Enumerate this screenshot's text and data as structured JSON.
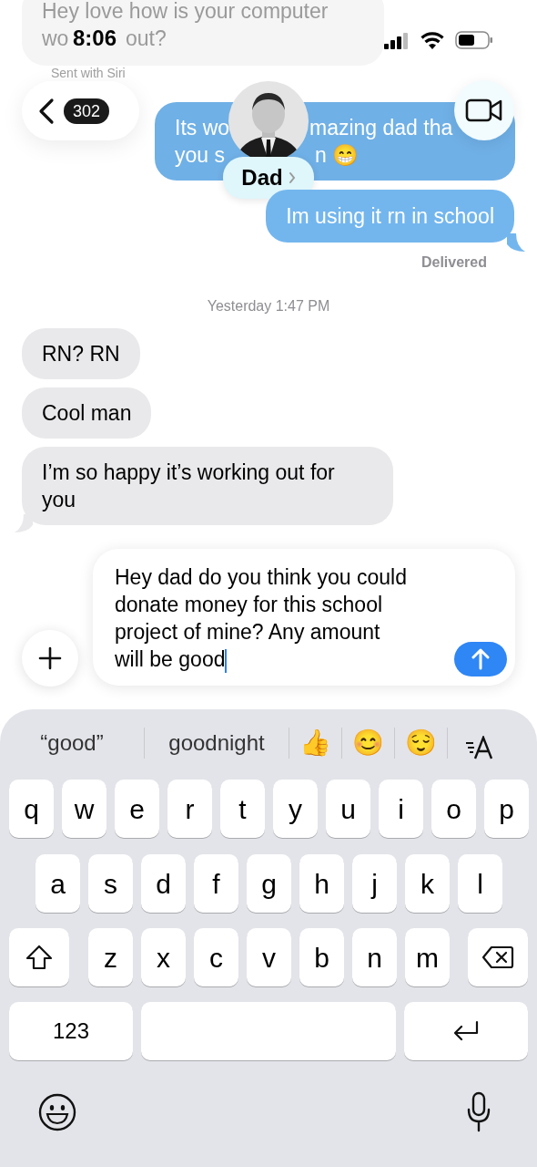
{
  "status_bar": {
    "time": "8:06"
  },
  "behind_header": {
    "incoming": {
      "fragments": [
        "Hey love how is your computer",
        "wo",
        "out?"
      ],
      "note": "Sent with Siri"
    },
    "outgoing_fragments": [
      "Its wo",
      "mazing dad tha",
      "you s",
      "n 😁"
    ]
  },
  "nav": {
    "back_count": "302",
    "contact_name": "Dad"
  },
  "messages": [
    {
      "kind": "sent",
      "text": "Im using it rn in school",
      "status": "Delivered"
    },
    {
      "kind": "timestamp",
      "text": "Yesterday 1:47 PM"
    },
    {
      "kind": "received",
      "text": "RN? RN",
      "tail": false
    },
    {
      "kind": "received",
      "text": "Cool man",
      "tail": false
    },
    {
      "kind": "received",
      "text": "I’m so happy it’s working out for you",
      "tail": true
    }
  ],
  "compose": {
    "text": "Hey dad do you think you could donate money for this school project of mine? Any amount will be good"
  },
  "suggestions": [
    {
      "kind": "text",
      "text": "“good”"
    },
    {
      "kind": "text",
      "text": "goodnight"
    },
    {
      "kind": "emoji",
      "text": "👍"
    },
    {
      "kind": "emoji",
      "text": "😊"
    },
    {
      "kind": "emoji",
      "text": "😌"
    }
  ],
  "keyboard": {
    "rows": [
      [
        "q",
        "w",
        "e",
        "r",
        "t",
        "y",
        "u",
        "i",
        "o",
        "p"
      ],
      [
        "a",
        "s",
        "d",
        "f",
        "g",
        "h",
        "j",
        "k",
        "l"
      ],
      [
        "z",
        "x",
        "c",
        "v",
        "b",
        "n",
        "m"
      ]
    ],
    "numbers_key": "123"
  }
}
